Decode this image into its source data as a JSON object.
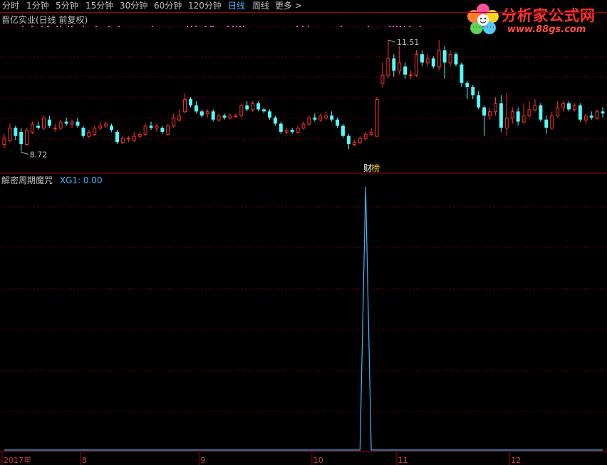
{
  "toolbar": {
    "items": [
      "分时",
      "1分钟",
      "5分钟",
      "15分钟",
      "30分钟",
      "60分钟",
      "120分钟",
      "日线",
      "周线",
      "更多 >"
    ],
    "active": "日线"
  },
  "main_chart": {
    "title": "晋亿实业(日线 前复权)",
    "low_label": "8.72",
    "high_label": "11.51",
    "event_label": "财",
    "event_label2": "榜"
  },
  "indicator": {
    "name": "解密周期魔咒",
    "value_label": "XG1: 0.00"
  },
  "logo": {
    "text": "分析家公式网",
    "url": "www.88gs.com"
  },
  "colors": {
    "up": "#ff3232",
    "down": "#54fcfc",
    "axis": "#a00000",
    "grid": "#a00000",
    "line": "#3fb7ff"
  },
  "chart_data": {
    "type": "candlestick",
    "x_axis": {
      "tick_labels": [
        "2017年",
        "8",
        "9",
        "10",
        "11",
        "12"
      ],
      "tick_index": [
        0,
        14,
        35,
        55,
        70,
        90
      ]
    },
    "ylim": [
      8.5,
      11.8
    ],
    "candles": [
      {
        "o": 8.9,
        "c": 9.05,
        "h": 9.15,
        "l": 8.8,
        "d": "up"
      },
      {
        "o": 9.0,
        "c": 9.3,
        "h": 9.4,
        "l": 8.95,
        "d": "up"
      },
      {
        "o": 9.3,
        "c": 9.1,
        "h": 9.35,
        "l": 9.0,
        "d": "down"
      },
      {
        "o": 9.2,
        "c": 8.9,
        "h": 9.3,
        "l": 8.72,
        "d": "down"
      },
      {
        "o": 8.9,
        "c": 9.25,
        "h": 9.3,
        "l": 8.85,
        "d": "up"
      },
      {
        "o": 9.2,
        "c": 9.4,
        "h": 9.45,
        "l": 9.15,
        "d": "up"
      },
      {
        "o": 9.35,
        "c": 9.3,
        "h": 9.45,
        "l": 9.25,
        "d": "down"
      },
      {
        "o": 9.3,
        "c": 9.55,
        "h": 9.6,
        "l": 9.25,
        "d": "up"
      },
      {
        "o": 9.5,
        "c": 9.35,
        "h": 9.6,
        "l": 9.3,
        "d": "down"
      },
      {
        "o": 9.3,
        "c": 9.3,
        "h": 9.4,
        "l": 9.2,
        "d": "up"
      },
      {
        "o": 9.3,
        "c": 9.45,
        "h": 9.5,
        "l": 9.25,
        "d": "up"
      },
      {
        "o": 9.45,
        "c": 9.4,
        "h": 9.55,
        "l": 9.35,
        "d": "down"
      },
      {
        "o": 9.4,
        "c": 9.45,
        "h": 9.5,
        "l": 9.3,
        "d": "up"
      },
      {
        "o": 9.45,
        "c": 9.35,
        "h": 9.55,
        "l": 9.3,
        "d": "down"
      },
      {
        "o": 9.3,
        "c": 9.1,
        "h": 9.35,
        "l": 9.05,
        "d": "down"
      },
      {
        "o": 9.1,
        "c": 9.2,
        "h": 9.25,
        "l": 9.05,
        "d": "up"
      },
      {
        "o": 9.15,
        "c": 9.3,
        "h": 9.35,
        "l": 9.1,
        "d": "up"
      },
      {
        "o": 9.3,
        "c": 9.35,
        "h": 9.45,
        "l": 9.25,
        "d": "up"
      },
      {
        "o": 9.35,
        "c": 9.4,
        "h": 9.45,
        "l": 9.3,
        "d": "up"
      },
      {
        "o": 9.35,
        "c": 9.25,
        "h": 9.4,
        "l": 9.2,
        "d": "down"
      },
      {
        "o": 9.2,
        "c": 8.95,
        "h": 9.25,
        "l": 8.9,
        "d": "down"
      },
      {
        "o": 8.95,
        "c": 9.05,
        "h": 9.1,
        "l": 8.9,
        "d": "up"
      },
      {
        "o": 9.05,
        "c": 9.05,
        "h": 9.1,
        "l": 8.95,
        "d": "up"
      },
      {
        "o": 9.0,
        "c": 9.1,
        "h": 9.2,
        "l": 8.95,
        "d": "up"
      },
      {
        "o": 9.1,
        "c": 9.15,
        "h": 9.2,
        "l": 9.05,
        "d": "up"
      },
      {
        "o": 9.15,
        "c": 9.35,
        "h": 9.4,
        "l": 9.1,
        "d": "up"
      },
      {
        "o": 9.35,
        "c": 9.3,
        "h": 9.45,
        "l": 9.25,
        "d": "down"
      },
      {
        "o": 9.3,
        "c": 9.35,
        "h": 9.4,
        "l": 9.2,
        "d": "up"
      },
      {
        "o": 9.3,
        "c": 9.2,
        "h": 9.35,
        "l": 9.15,
        "d": "down"
      },
      {
        "o": 9.15,
        "c": 9.35,
        "h": 9.4,
        "l": 9.1,
        "d": "up"
      },
      {
        "o": 9.35,
        "c": 9.55,
        "h": 9.65,
        "l": 9.3,
        "d": "up"
      },
      {
        "o": 9.5,
        "c": 9.6,
        "h": 9.75,
        "l": 9.45,
        "d": "up"
      },
      {
        "o": 9.7,
        "c": 10.0,
        "h": 10.15,
        "l": 9.65,
        "d": "up"
      },
      {
        "o": 10.0,
        "c": 9.85,
        "h": 10.05,
        "l": 9.8,
        "d": "down"
      },
      {
        "o": 9.85,
        "c": 9.7,
        "h": 9.95,
        "l": 9.65,
        "d": "down"
      },
      {
        "o": 9.7,
        "c": 9.6,
        "h": 9.75,
        "l": 9.55,
        "d": "down"
      },
      {
        "o": 9.65,
        "c": 9.7,
        "h": 9.75,
        "l": 9.55,
        "d": "up"
      },
      {
        "o": 9.7,
        "c": 9.5,
        "h": 9.75,
        "l": 9.45,
        "d": "down"
      },
      {
        "o": 9.5,
        "c": 9.6,
        "h": 9.65,
        "l": 9.45,
        "d": "up"
      },
      {
        "o": 9.6,
        "c": 9.55,
        "h": 9.65,
        "l": 9.5,
        "d": "down"
      },
      {
        "o": 9.55,
        "c": 9.6,
        "h": 9.65,
        "l": 9.5,
        "d": "up"
      },
      {
        "o": 9.6,
        "c": 9.6,
        "h": 9.65,
        "l": 9.55,
        "d": "up"
      },
      {
        "o": 9.6,
        "c": 9.85,
        "h": 9.9,
        "l": 9.55,
        "d": "up"
      },
      {
        "o": 9.85,
        "c": 9.75,
        "h": 9.95,
        "l": 9.7,
        "d": "down"
      },
      {
        "o": 9.75,
        "c": 9.9,
        "h": 9.95,
        "l": 9.7,
        "d": "up"
      },
      {
        "o": 9.9,
        "c": 9.75,
        "h": 9.95,
        "l": 9.7,
        "d": "down"
      },
      {
        "o": 9.75,
        "c": 9.7,
        "h": 9.8,
        "l": 9.65,
        "d": "down"
      },
      {
        "o": 9.7,
        "c": 9.55,
        "h": 9.75,
        "l": 9.5,
        "d": "down"
      },
      {
        "o": 9.55,
        "c": 9.4,
        "h": 9.6,
        "l": 9.35,
        "d": "down"
      },
      {
        "o": 9.4,
        "c": 9.2,
        "h": 9.45,
        "l": 9.15,
        "d": "down"
      },
      {
        "o": 9.2,
        "c": 9.25,
        "h": 9.3,
        "l": 9.15,
        "d": "up"
      },
      {
        "o": 9.25,
        "c": 9.2,
        "h": 9.3,
        "l": 9.15,
        "d": "down"
      },
      {
        "o": 9.2,
        "c": 9.3,
        "h": 9.35,
        "l": 9.15,
        "d": "up"
      },
      {
        "o": 9.3,
        "c": 9.4,
        "h": 9.45,
        "l": 9.25,
        "d": "up"
      },
      {
        "o": 9.4,
        "c": 9.55,
        "h": 9.6,
        "l": 9.35,
        "d": "up"
      },
      {
        "o": 9.55,
        "c": 9.5,
        "h": 9.65,
        "l": 9.45,
        "d": "down"
      },
      {
        "o": 9.5,
        "c": 9.6,
        "h": 9.65,
        "l": 9.45,
        "d": "up"
      },
      {
        "o": 9.55,
        "c": 9.6,
        "h": 9.7,
        "l": 9.5,
        "d": "up"
      },
      {
        "o": 9.6,
        "c": 9.5,
        "h": 9.7,
        "l": 9.45,
        "d": "down"
      },
      {
        "o": 9.5,
        "c": 9.35,
        "h": 9.55,
        "l": 9.3,
        "d": "down"
      },
      {
        "o": 9.35,
        "c": 9.1,
        "h": 9.4,
        "l": 9.05,
        "d": "down"
      },
      {
        "o": 9.1,
        "c": 8.9,
        "h": 9.15,
        "l": 8.78,
        "d": "down"
      },
      {
        "o": 8.9,
        "c": 8.95,
        "h": 9.0,
        "l": 8.85,
        "d": "up"
      },
      {
        "o": 8.95,
        "c": 9.05,
        "h": 9.1,
        "l": 8.9,
        "d": "up"
      },
      {
        "o": 9.05,
        "c": 9.15,
        "h": 9.2,
        "l": 9.0,
        "d": "up"
      },
      {
        "o": 9.15,
        "c": 9.2,
        "h": 9.3,
        "l": 9.1,
        "d": "up"
      },
      {
        "o": 9.1,
        "c": 10.0,
        "h": 10.05,
        "l": 9.1,
        "d": "up"
      },
      {
        "o": 10.4,
        "c": 10.6,
        "h": 10.9,
        "l": 10.3,
        "d": "up"
      },
      {
        "o": 10.6,
        "c": 11.0,
        "h": 11.45,
        "l": 10.5,
        "d": "up"
      },
      {
        "o": 11.0,
        "c": 10.7,
        "h": 11.1,
        "l": 10.55,
        "d": "down"
      },
      {
        "o": 10.7,
        "c": 10.9,
        "h": 11.3,
        "l": 10.6,
        "d": "up"
      },
      {
        "o": 10.8,
        "c": 10.6,
        "h": 10.9,
        "l": 10.5,
        "d": "down"
      },
      {
        "o": 10.6,
        "c": 10.6,
        "h": 10.7,
        "l": 10.5,
        "d": "up"
      },
      {
        "o": 10.6,
        "c": 11.1,
        "h": 11.2,
        "l": 10.55,
        "d": "up"
      },
      {
        "o": 11.1,
        "c": 10.9,
        "h": 11.2,
        "l": 10.8,
        "d": "down"
      },
      {
        "o": 10.9,
        "c": 11.0,
        "h": 11.1,
        "l": 10.8,
        "d": "up"
      },
      {
        "o": 11.0,
        "c": 10.8,
        "h": 11.05,
        "l": 10.75,
        "d": "down"
      },
      {
        "o": 10.8,
        "c": 11.2,
        "h": 11.45,
        "l": 10.7,
        "d": "up"
      },
      {
        "o": 11.2,
        "c": 10.9,
        "h": 11.3,
        "l": 10.5,
        "d": "down"
      },
      {
        "o": 10.9,
        "c": 11.1,
        "h": 11.2,
        "l": 10.8,
        "d": "up"
      },
      {
        "o": 11.1,
        "c": 10.85,
        "h": 11.15,
        "l": 10.8,
        "d": "down"
      },
      {
        "o": 10.85,
        "c": 10.4,
        "h": 10.9,
        "l": 10.3,
        "d": "down"
      },
      {
        "o": 10.4,
        "c": 10.3,
        "h": 10.45,
        "l": 10.0,
        "d": "down"
      },
      {
        "o": 10.3,
        "c": 10.1,
        "h": 10.35,
        "l": 10.0,
        "d": "down"
      },
      {
        "o": 10.1,
        "c": 9.8,
        "h": 10.2,
        "l": 9.75,
        "d": "down"
      },
      {
        "o": 9.8,
        "c": 9.6,
        "h": 9.85,
        "l": 9.1,
        "d": "down"
      },
      {
        "o": 9.6,
        "c": 9.7,
        "h": 9.8,
        "l": 9.5,
        "d": "up"
      },
      {
        "o": 9.7,
        "c": 9.9,
        "h": 10.05,
        "l": 9.6,
        "d": "up"
      },
      {
        "o": 9.9,
        "c": 9.3,
        "h": 10.1,
        "l": 9.2,
        "d": "down"
      },
      {
        "o": 9.3,
        "c": 9.55,
        "h": 10.15,
        "l": 9.1,
        "d": "up"
      },
      {
        "o": 9.55,
        "c": 9.7,
        "h": 9.8,
        "l": 9.4,
        "d": "up"
      },
      {
        "o": 9.7,
        "c": 9.45,
        "h": 9.8,
        "l": 9.35,
        "d": "down"
      },
      {
        "o": 9.45,
        "c": 9.6,
        "h": 9.9,
        "l": 9.4,
        "d": "up"
      },
      {
        "o": 9.6,
        "c": 9.75,
        "h": 9.95,
        "l": 9.55,
        "d": "up"
      },
      {
        "o": 9.75,
        "c": 9.85,
        "h": 10.0,
        "l": 9.7,
        "d": "up"
      },
      {
        "o": 9.85,
        "c": 9.5,
        "h": 9.9,
        "l": 9.45,
        "d": "down"
      },
      {
        "o": 9.5,
        "c": 9.3,
        "h": 9.6,
        "l": 9.15,
        "d": "down"
      },
      {
        "o": 9.3,
        "c": 9.6,
        "h": 9.7,
        "l": 9.25,
        "d": "up"
      },
      {
        "o": 9.6,
        "c": 9.8,
        "h": 9.95,
        "l": 9.55,
        "d": "up"
      },
      {
        "o": 9.8,
        "c": 9.9,
        "h": 9.95,
        "l": 9.7,
        "d": "up"
      },
      {
        "o": 9.9,
        "c": 9.75,
        "h": 9.95,
        "l": 9.7,
        "d": "down"
      },
      {
        "o": 9.75,
        "c": 9.85,
        "h": 9.9,
        "l": 9.7,
        "d": "up"
      },
      {
        "o": 9.85,
        "c": 9.5,
        "h": 9.9,
        "l": 9.45,
        "d": "down"
      },
      {
        "o": 9.5,
        "c": 9.6,
        "h": 9.65,
        "l": 9.4,
        "d": "up"
      },
      {
        "o": 9.6,
        "c": 9.55,
        "h": 9.7,
        "l": 9.5,
        "d": "down"
      },
      {
        "o": 9.55,
        "c": 9.7,
        "h": 9.75,
        "l": 9.5,
        "d": "up"
      },
      {
        "o": 9.7,
        "c": 9.65,
        "h": 9.8,
        "l": 9.55,
        "d": "down"
      }
    ],
    "indicator_series": {
      "name": "XG1",
      "spike_index": 64,
      "spike_value": 1,
      "baseline": 0
    }
  }
}
